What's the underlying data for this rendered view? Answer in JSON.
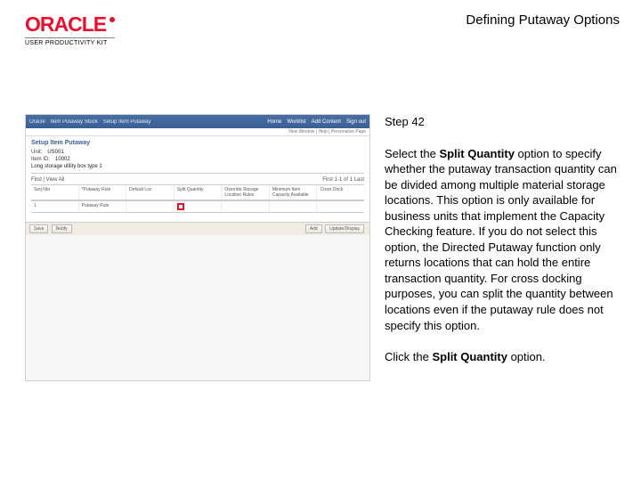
{
  "header": {
    "brand_word": "ORACLE",
    "brand_sub": "USER PRODUCTIVITY KIT",
    "title": "Defining Putaway Options"
  },
  "screenshot": {
    "topbar_left": [
      "Oracle",
      "Item Putaway Stock",
      "Setup Item Putaway"
    ],
    "topbar_right": [
      "Home",
      "Worklist",
      "Add Content",
      "Sign out"
    ],
    "subbar": "New Window | Help | Personalize Page",
    "page_header": "Setup Item Putaway",
    "fields": {
      "unit_lbl": "Unit:",
      "unit_val": "US001",
      "itemid_lbl": "Item ID:",
      "itemid_val": "10002",
      "desc_lbl": "Long storage utility box type 1"
    },
    "grid_caption_left": "Find | View All",
    "grid_caption_right": "First  1-1 of 1  Last",
    "cols": [
      "Seq Nbr",
      "*Putaway Rule",
      "Default Loc",
      "Split Quantity",
      "Override Storage Location Rules",
      "Minimum Item Capacity Available",
      "Cross Dock"
    ],
    "vals": [
      "1",
      "Putaway Rule",
      "",
      "",
      "",
      "",
      ""
    ],
    "footer_left": [
      "Save",
      "Notify"
    ],
    "footer_right": [
      "Add",
      "Update/Display"
    ]
  },
  "instructions": {
    "step_label": "Step 42",
    "para1_a": "Select the ",
    "para1_b": "Split Quantity",
    "para1_c": " option to specify whether the putaway transaction quantity can be divided among multiple material storage locations. This option is only available for business units that implement the Capacity Checking feature. If you do not select this option, the Directed Putaway function only returns locations that can hold the entire transaction quantity. For cross docking purposes, you can split the quantity between locations even if the putaway rule does not specify this option.",
    "para2_a": "Click the ",
    "para2_b": "Split Quantity",
    "para2_c": " option."
  }
}
